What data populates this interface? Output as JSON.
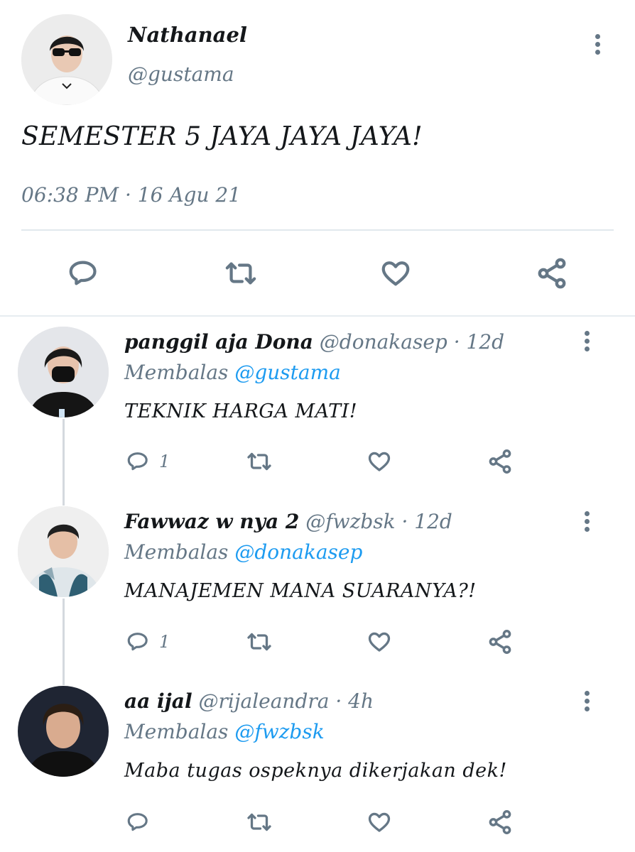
{
  "main_tweet": {
    "display_name": "Nathanael",
    "handle": "@gustama",
    "text": "SEMESTER 5 JAYA JAYA JAYA!",
    "timestamp": "06:38 PM · 16 Agu 21"
  },
  "replies": [
    {
      "display_name": "panggil aja Dona",
      "handle": "@donakasep",
      "time": "· 12d",
      "replying_label": "Membalas",
      "replying_to": "@gustama",
      "text": "TEKNIK HARGA MATI!",
      "reply_count": "1"
    },
    {
      "display_name": "Fawwaz w nya 2",
      "handle": "@fwzbsk",
      "time": "· 12d",
      "replying_label": "Membalas",
      "replying_to": "@donakasep",
      "text": "MANAJEMEN MANA SUARANYA?!",
      "reply_count": "1"
    },
    {
      "display_name": "aa ijal",
      "handle": "@rijaleandra",
      "time": "· 4h",
      "replying_label": "Membalas",
      "replying_to": "@fwzbsk",
      "text": "Maba tugas ospeknya dikerjakan dek!",
      "reply_count": ""
    }
  ],
  "icons": {
    "reply": "reply-bubble-icon",
    "retweet": "retweet-icon",
    "like": "heart-icon",
    "share": "share-icon",
    "more": "kebab-menu-icon"
  },
  "colors": {
    "text": "#14171a",
    "secondary": "#657786",
    "link": "#1d9bf0",
    "divider": "#e1e8ed"
  }
}
